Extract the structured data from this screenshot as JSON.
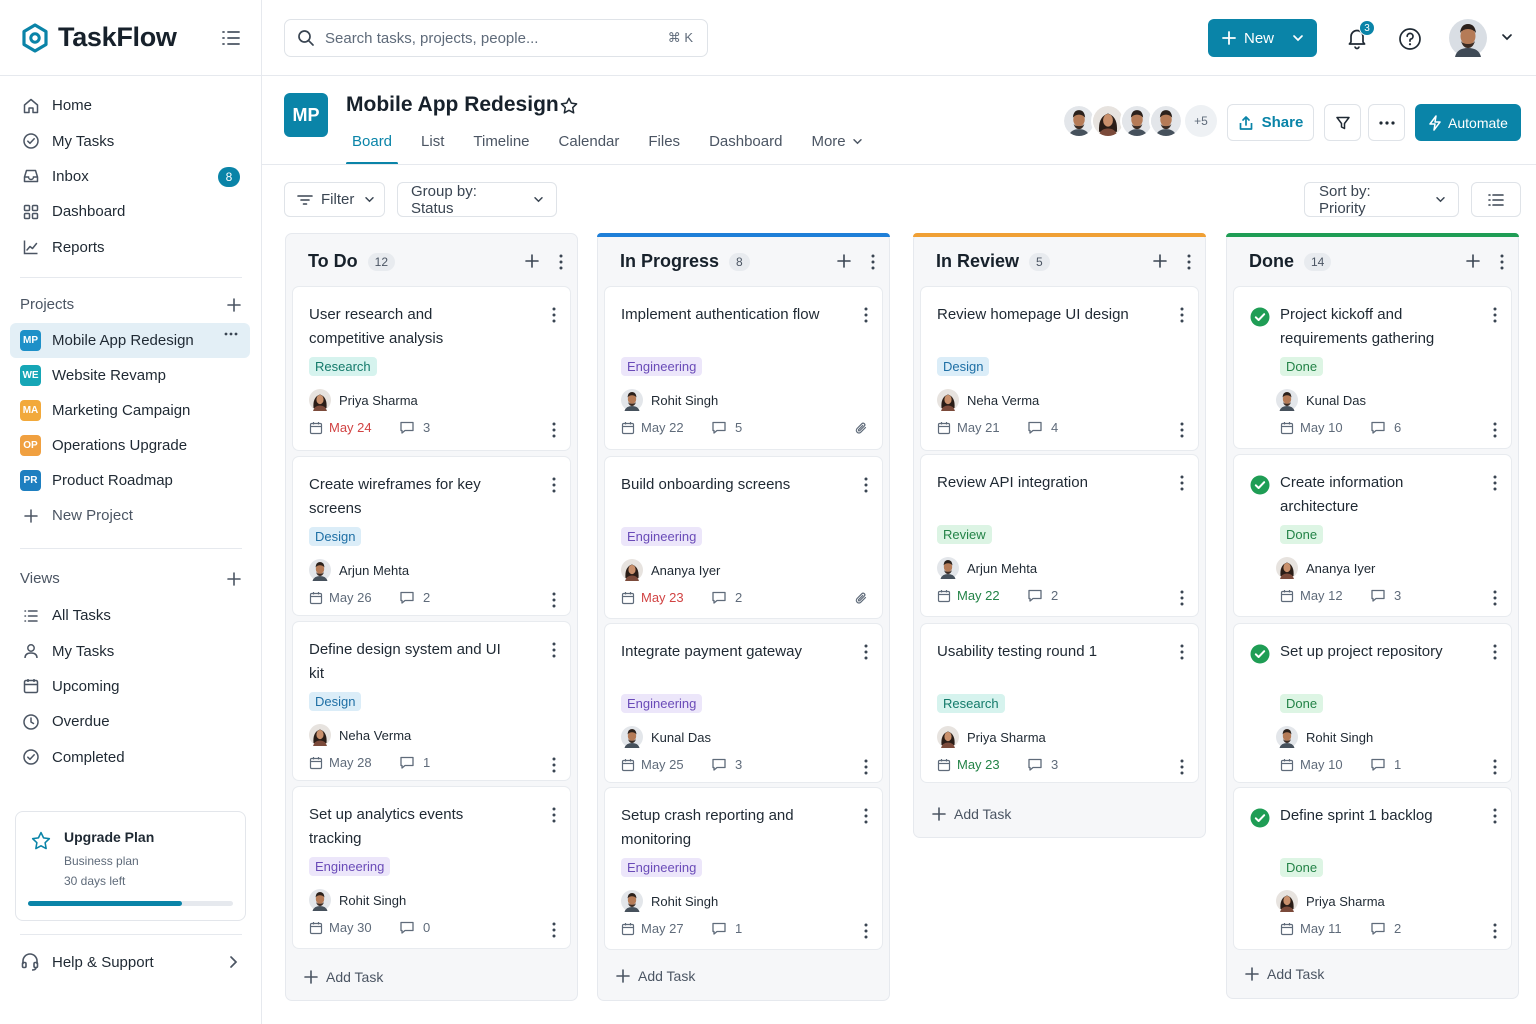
{
  "app": {
    "name": "TaskFlow"
  },
  "colors": {
    "accent": "#0a84a8",
    "in_progress": "#1e7fd8",
    "in_review": "#f0a035",
    "done": "#1f9d55",
    "overdue": "#d14343"
  },
  "nav": [
    {
      "label": "Home",
      "icon": "home-icon"
    },
    {
      "label": "My Tasks",
      "icon": "check-circle-icon"
    },
    {
      "label": "Inbox",
      "icon": "inbox-icon",
      "badge": "8"
    },
    {
      "label": "Dashboard",
      "icon": "grid-icon"
    },
    {
      "label": "Reports",
      "icon": "chart-icon"
    }
  ],
  "projects": {
    "heading": "Projects",
    "items": [
      {
        "badge": "MP",
        "label": "Mobile App Redesign",
        "color": "#1e90c8",
        "active": true
      },
      {
        "badge": "WE",
        "label": "Website Revamp",
        "color": "#16a6b6"
      },
      {
        "badge": "MA",
        "label": "Marketing Campaign",
        "color": "#f2a93b"
      },
      {
        "badge": "OP",
        "label": "Operations Upgrade",
        "color": "#f0a040"
      },
      {
        "badge": "PR",
        "label": "Product Roadmap",
        "color": "#1e7fc0"
      }
    ],
    "new_label": "New Project"
  },
  "views": {
    "heading": "Views",
    "items": [
      {
        "label": "All Tasks",
        "icon": "list-icon"
      },
      {
        "label": "My Tasks",
        "icon": "user-icon"
      },
      {
        "label": "Upcoming",
        "icon": "calendar-icon"
      },
      {
        "label": "Overdue",
        "icon": "clock-icon"
      },
      {
        "label": "Completed",
        "icon": "check-circle-icon"
      }
    ]
  },
  "upgrade": {
    "title": "Upgrade Plan",
    "plan": "Business plan",
    "days": "30 days left",
    "progress": 0.75
  },
  "help": {
    "label": "Help & Support"
  },
  "search": {
    "placeholder": "Search tasks, projects, people...",
    "shortcut": "⌘ K"
  },
  "header": {
    "new_label": "New",
    "notifications": "3"
  },
  "project": {
    "badge": "MP",
    "title": "Mobile App Redesign",
    "tabs": [
      "Board",
      "List",
      "Timeline",
      "Calendar",
      "Files",
      "Dashboard",
      "More"
    ],
    "active_tab": "Board",
    "members_more": "+5",
    "share_label": "Share",
    "automate_label": "Automate"
  },
  "toolbar": {
    "filter": "Filter",
    "group_by": "Group by: Status",
    "sort_by": "Sort by: Priority"
  },
  "add_task_label": "Add Task",
  "columns": [
    {
      "title": "To Do",
      "count": "12",
      "accent": "",
      "cards": [
        {
          "title": "User research and competitive analysis",
          "tag": "Research",
          "tag_type": "research",
          "assignee": "Priya Sharma",
          "avatar": "f",
          "date": "May 24",
          "date_style": "red",
          "comments": "3"
        },
        {
          "title": "Create wireframes for key screens",
          "tag": "Design",
          "tag_type": "design",
          "assignee": "Arjun Mehta",
          "avatar": "m",
          "date": "May 26",
          "comments": "2"
        },
        {
          "title": "Define design system and UI kit",
          "tag": "Design",
          "tag_type": "design",
          "assignee": "Neha Verma",
          "avatar": "f",
          "date": "May 28",
          "comments": "1"
        },
        {
          "title": "Set up analytics events tracking",
          "tag": "Engineering",
          "tag_type": "engineering",
          "assignee": "Rohit Singh",
          "avatar": "m",
          "date": "May 30",
          "comments": "0"
        }
      ]
    },
    {
      "title": "In Progress",
      "count": "8",
      "accent": "#1e7fd8",
      "cards": [
        {
          "title": "Implement authentication flow",
          "tag": "Engineering",
          "tag_type": "engineering",
          "assignee": "Rohit Singh",
          "avatar": "m",
          "date": "May 22",
          "comments": "5",
          "clip": true
        },
        {
          "title": "Build onboarding screens",
          "tag": "Engineering",
          "tag_type": "engineering",
          "assignee": "Ananya Iyer",
          "avatar": "f",
          "date": "May 23",
          "date_style": "red",
          "comments": "2",
          "clip": true
        },
        {
          "title": "Integrate payment gateway",
          "tag": "Engineering",
          "tag_type": "engineering",
          "assignee": "Kunal Das",
          "avatar": "m",
          "date": "May 25",
          "comments": "3"
        },
        {
          "title": "Setup crash reporting and monitoring",
          "tag": "Engineering",
          "tag_type": "engineering",
          "assignee": "Rohit Singh",
          "avatar": "m",
          "date": "May 27",
          "comments": "1"
        }
      ]
    },
    {
      "title": "In Review",
      "count": "5",
      "accent": "#f0a035",
      "cards": [
        {
          "title": "Review homepage UI design",
          "tag": "Design",
          "tag_type": "design",
          "assignee": "Neha Verma",
          "avatar": "f",
          "date": "May 21",
          "comments": "4"
        },
        {
          "title": "Review API integration",
          "tag": "Review",
          "tag_type": "review",
          "assignee": "Arjun Mehta",
          "avatar": "m",
          "date": "May 22",
          "date_style": "green",
          "comments": "2"
        },
        {
          "title": "Usability testing round 1",
          "tag": "Research",
          "tag_type": "research",
          "assignee": "Priya Sharma",
          "avatar": "f",
          "date": "May 23",
          "date_style": "green",
          "comments": "3"
        }
      ]
    },
    {
      "title": "Done",
      "count": "14",
      "accent": "#1f9d55",
      "cards": [
        {
          "title": "Project kickoff and requirements gathering",
          "tag": "Done",
          "tag_type": "done",
          "assignee": "Kunal Das",
          "avatar": "m",
          "date": "May 10",
          "comments": "6"
        },
        {
          "title": "Create information architecture",
          "tag": "Done",
          "tag_type": "done",
          "assignee": "Ananya Iyer",
          "avatar": "f",
          "date": "May 12",
          "comments": "3"
        },
        {
          "title": "Set up project repository",
          "tag": "Done",
          "tag_type": "done",
          "assignee": "Rohit Singh",
          "avatar": "m",
          "date": "May 10",
          "comments": "1"
        },
        {
          "title": "Define sprint 1 backlog",
          "tag": "Done",
          "tag_type": "done",
          "assignee": "Priya Sharma",
          "avatar": "f",
          "date": "May 11",
          "comments": "2"
        }
      ]
    }
  ]
}
